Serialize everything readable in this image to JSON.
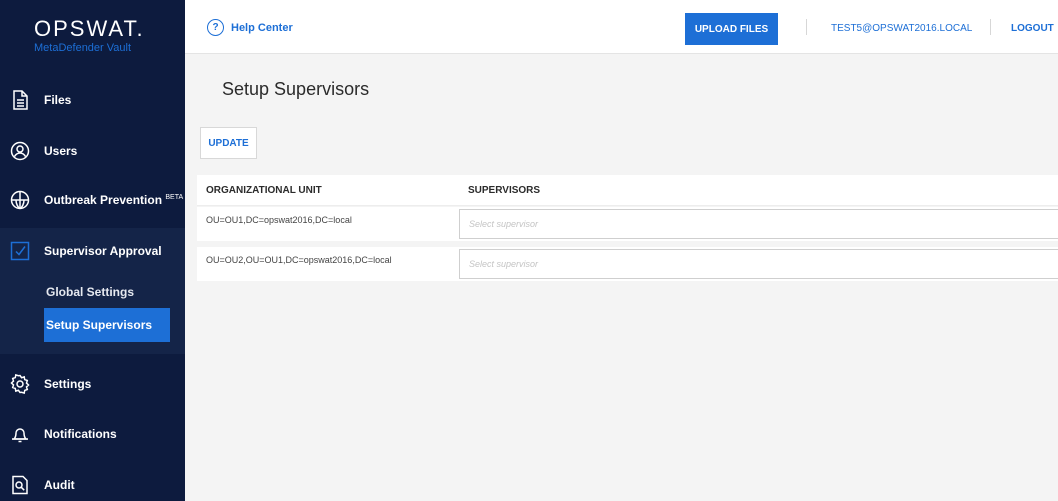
{
  "brand": {
    "name": "OPSWAT.",
    "product": "MetaDefender Vault"
  },
  "sidebar": {
    "items": [
      {
        "label": "Files"
      },
      {
        "label": "Users"
      },
      {
        "label": "Outbreak Prevention",
        "badge": "BETA"
      },
      {
        "label": "Supervisor Approval"
      },
      {
        "label": "Settings"
      },
      {
        "label": "Notifications"
      },
      {
        "label": "Audit"
      }
    ],
    "sub_items": [
      {
        "label": "Global Settings"
      },
      {
        "label": "Setup Supervisors",
        "active": true
      }
    ]
  },
  "topbar": {
    "help_label": "Help Center",
    "upload_label": "UPLOAD FILES",
    "user_label": "TEST5@OPSWAT2016.LOCAL",
    "logout_label": "LOGOUT"
  },
  "main": {
    "title": "Setup Supervisors",
    "update_label": "UPDATE",
    "table": {
      "headers": [
        "ORGANIZATIONAL UNIT",
        "SUPERVISORS"
      ],
      "rows": [
        {
          "ou": "OU=OU1,DC=opswat2016,DC=local",
          "supervisor_placeholder": "Select supervisor"
        },
        {
          "ou": "OU=OU2,OU=OU1,DC=opswat2016,DC=local",
          "supervisor_placeholder": "Select supervisor"
        }
      ]
    }
  },
  "colors": {
    "sidebar_bg": "#0d1b3e",
    "accent": "#1d6fd6",
    "page_bg": "#f4f4f4"
  }
}
